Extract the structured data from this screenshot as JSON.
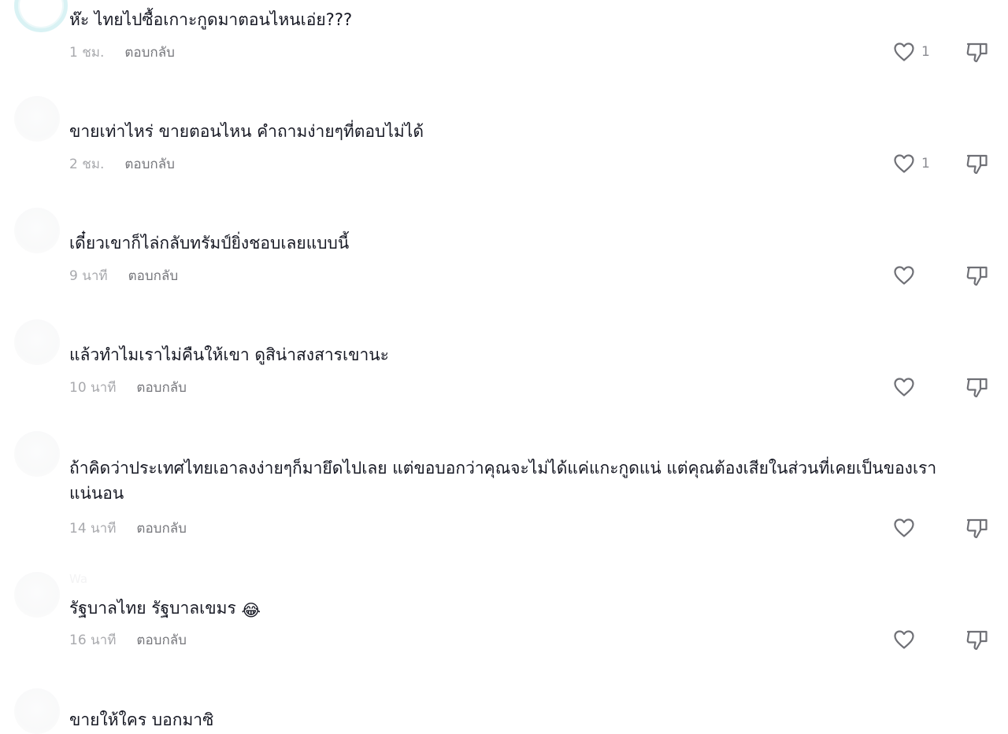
{
  "comments": [
    {
      "username": "",
      "text": "ห๊ะ ไทยไปซื้อเกาะกูดมาตอนไหนเอ่ย???",
      "time": "1 ชม.",
      "reply_label": "ตอบกลับ",
      "likes": "1"
    },
    {
      "username": "",
      "text": "ขายเท่าไหร่ ขายตอนไหน คำถามง่ายๆที่ตอบไม่ได้",
      "time": "2 ชม.",
      "reply_label": "ตอบกลับ",
      "likes": "1"
    },
    {
      "username": "",
      "text": "เดี๋ยวเขาก็ไล่กลับทรัมป์ยิ่งชอบเลยแบบนี้",
      "time": "9 นาที",
      "reply_label": "ตอบกลับ",
      "likes": ""
    },
    {
      "username": "",
      "text": "แล้วทำไมเราไม่คืนให้เขา ดูสิน่าสงสารเขานะ",
      "time": "10 นาที",
      "reply_label": "ตอบกลับ",
      "likes": ""
    },
    {
      "username": "",
      "text": "ถ้าคิดว่าประเทศไทยเอาลงง่ายๆก็มายึดไปเลย แต่ขอบอกว่าคุณจะไม่ได้แค่แกะกูดแน่ แต่คุณต้องเสียในส่วนที่เคยเป็นของเรา แน่นอน",
      "time": "14 นาที",
      "reply_label": "ตอบกลับ",
      "likes": ""
    },
    {
      "username": "Wa",
      "text": "รัฐบาลไทย รัฐบาลเขมร",
      "time": "16 นาที",
      "reply_label": "ตอบกลับ",
      "likes": "",
      "emoji": "😂"
    },
    {
      "username": "",
      "text": "ขายให้ใคร บอกมาซิ",
      "time": "",
      "reply_label": "",
      "likes": ""
    }
  ],
  "icons": {
    "like": "heart-outline-icon",
    "dislike": "thumbs-down-icon"
  },
  "colors": {
    "text": "#161823",
    "time": "#a8a9ad",
    "reply": "#75767b",
    "icon": "#6f7076",
    "avatar_ring": "#d5f1f3"
  }
}
